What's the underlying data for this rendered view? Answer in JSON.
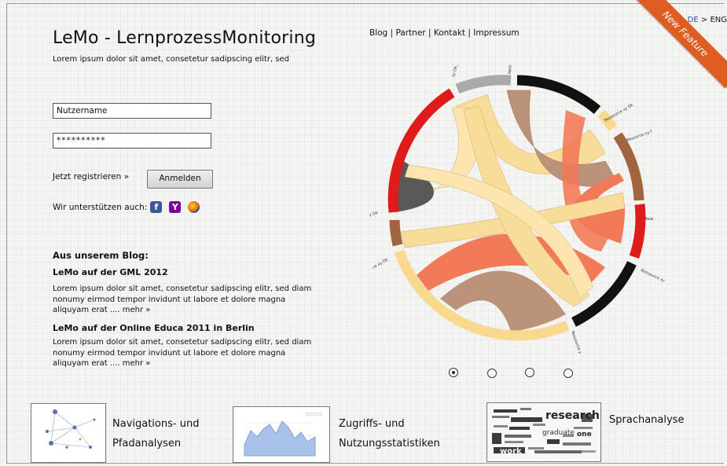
{
  "header": {
    "title": "LeMo - LernprozessMonitoring",
    "subtitle": "Lorem ipsum dolor sit amet, consetetur  sadipscing  elitr, sed",
    "nav": [
      "Blog",
      "Partner",
      "Kontakt",
      "Impressum"
    ],
    "lang_active": "DE",
    "lang_sep": " > ",
    "lang_other": "ENG",
    "ribbon": "New Feature"
  },
  "login": {
    "username_value": "Nutzername",
    "password_value": "**********",
    "register_link": "Jetzt registrieren »",
    "login_button": "Anmelden",
    "support_label": "Wir unterstützen auch:",
    "support_icons": [
      "facebook-icon",
      "yahoo-icon",
      "firefox-icon"
    ]
  },
  "blog": {
    "heading": "Aus unserem Blog:",
    "posts": [
      {
        "title": "LeMo auf der GML 2012",
        "text": "Lorem ipsum dolor sit amet, consetetur sadipscing elitr, sed diam nonumy eirmod tempor invidunt ut labore et dolore magna aliquyam erat .... mehr »"
      },
      {
        "title": "LeMo auf der Online Educa 2011 in Berlin",
        "text": "Lorem ipsum dolor sit amet, consetetur sadipscing elitr, sed diam nonumy eirmod tempor invidunt ut labore et dolore magna aliquyam erat .... mehr »"
      }
    ]
  },
  "chord": {
    "labels": [
      "sy Ok_ ssbk",
      "Ress",
      "Ressource xy Ok",
      "Resource xy f",
      "Ress",
      "Ressource xy",
      "Ressource y",
      "ce xy Ok",
      "y Ok"
    ]
  },
  "carousel": {
    "count": 4,
    "active": 0
  },
  "features": [
    {
      "line1": "Navigations- und",
      "line2": "Pfadanalysen"
    },
    {
      "line1": "Zugriffs- und",
      "line2": "Nutzungsstatistiken"
    },
    {
      "line1": "Sprachanalyse",
      "line2": ""
    }
  ],
  "colors": {
    "red": "#e01b1b",
    "black": "#111111",
    "brown": "#a0653f",
    "peach": "#f9d98e",
    "orange": "#f26a43",
    "ribbon": "#e05d22"
  }
}
